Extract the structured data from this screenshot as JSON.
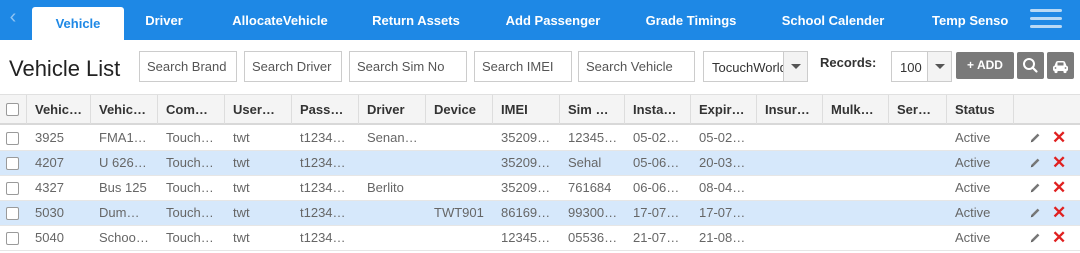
{
  "nav": {
    "tabs": [
      {
        "label": "Vehicle",
        "active": true
      },
      {
        "label": "Driver"
      },
      {
        "label": "AllocateVehicle"
      },
      {
        "label": "Return Assets"
      },
      {
        "label": "Add Passenger"
      },
      {
        "label": "Grade Timings"
      },
      {
        "label": "School Calender"
      },
      {
        "label": "Temp Sensor"
      }
    ]
  },
  "page": {
    "title": "Vehicle List"
  },
  "toolbar": {
    "search_brand_placeholder": "Search Brand",
    "search_driver_placeholder": "Search Driver",
    "search_sim_placeholder": "Search Sim No",
    "search_imei_placeholder": "Search IMEI",
    "search_vehicle_placeholder": "Search Vehicle",
    "company_select_value": "TocuchWorld",
    "records_label": "Records:",
    "records_value": "100",
    "add_label": "+ ADD",
    "search_button_icon": "search-icon",
    "vehicle_button_icon": "car-icon"
  },
  "table": {
    "headers": [
      "Vehic…",
      "Vehic…",
      "Com…",
      "User…",
      "Pass…",
      "Driver",
      "Device",
      "IMEI",
      "Sim …",
      "Insta…",
      "Expir…",
      "Insur…",
      "Mulk…",
      "Ser…",
      "Status"
    ],
    "rows": [
      [
        "3925",
        "FMA1…",
        "Touch…",
        "twt",
        "t1234…",
        "Senan…",
        "",
        "35209…",
        "12345…",
        "05-02…",
        "05-02…",
        "",
        "",
        "",
        "Active"
      ],
      [
        "4207",
        "U 626…",
        "Touch…",
        "twt",
        "t1234…",
        "",
        "",
        "35209…",
        "Sehal",
        "05-06…",
        "20-03…",
        "",
        "",
        "",
        "Active"
      ],
      [
        "4327",
        "Bus 125",
        "Touch…",
        "twt",
        "t1234…",
        "Berlito",
        "",
        "35209…",
        "761684",
        "06-06…",
        "08-04…",
        "",
        "",
        "",
        "Active"
      ],
      [
        "5030",
        "Dum…",
        "Touch…",
        "twt",
        "t1234…",
        "",
        "TWT901",
        "86169…",
        "99300…",
        "17-07…",
        "17-07…",
        "",
        "",
        "",
        "Active"
      ],
      [
        "5040",
        "Schoo…",
        "Touch…",
        "twt",
        "t1234…",
        "",
        "",
        "12345…",
        "05536…",
        "21-07…",
        "21-08…",
        "",
        "",
        "",
        "Active"
      ]
    ],
    "alt_rows": [
      1,
      3
    ]
  },
  "colors": {
    "nav_bg": "#1e88e5",
    "row_alt_bg": "#d6e8fb",
    "delete_red": "#e02020",
    "button_gray": "#7a7a7a"
  }
}
